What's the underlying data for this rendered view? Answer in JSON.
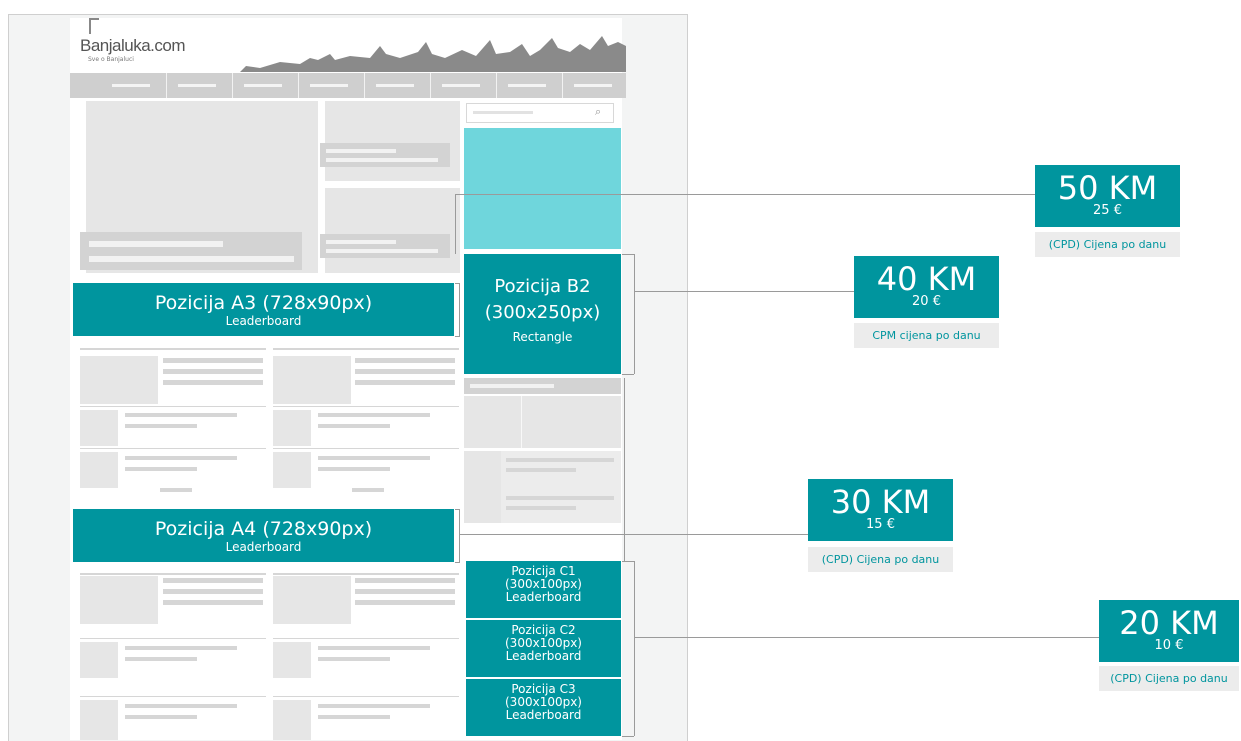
{
  "site": {
    "logo_text": "Banjaluka.com",
    "tagline": "Sve o Banjaluci"
  },
  "search": {
    "icon": "search-icon"
  },
  "ad_positions": {
    "a3": {
      "title": "Pozicija A3 (728x90px)",
      "subtitle": "Leaderboard"
    },
    "a4": {
      "title": "Pozicija A4 (728x90px)",
      "subtitle": "Leaderboard"
    },
    "b2": {
      "line1": "Pozicija B2",
      "line2": "(300x250px)",
      "subtitle": "Rectangle"
    },
    "c1": {
      "line1": "Pozicija C1",
      "line2": "(300x100px)",
      "subtitle": "Leaderboard"
    },
    "c2": {
      "line1": "Pozicija C2",
      "line2": "(300x100px)",
      "subtitle": "Leaderboard"
    },
    "c3": {
      "line1": "Pozicija C3",
      "line2": "(300x100px)",
      "subtitle": "Leaderboard"
    }
  },
  "prices": [
    {
      "km": "50 KM",
      "eur": "25 €",
      "note": "(CPD) Cijena po danu"
    },
    {
      "km": "40 KM",
      "eur": "20 €",
      "note": "CPM cijena po danu"
    },
    {
      "km": "30 KM",
      "eur": "15 €",
      "note": "(CPD) Cijena po danu"
    },
    {
      "km": "20 KM",
      "eur": "10 €",
      "note": "(CPD) Cijena po danu"
    }
  ],
  "colors": {
    "accent": "#00959e",
    "highlight": "#6fd6dc"
  }
}
